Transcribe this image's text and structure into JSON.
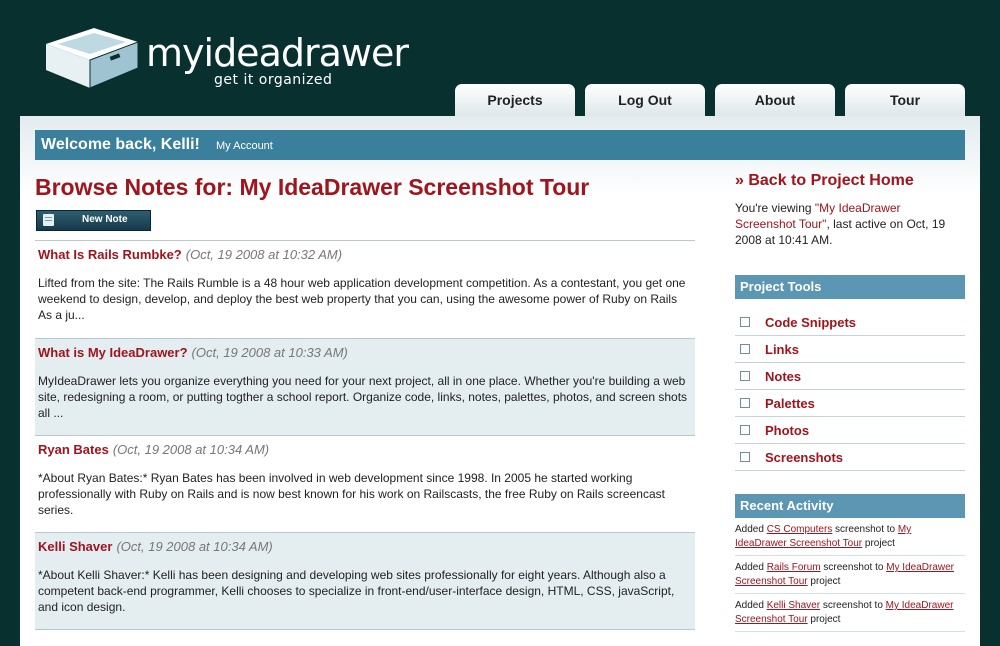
{
  "header": {
    "brand": "myideadrawer",
    "tagline": "get it organized",
    "tabs": [
      {
        "label": "Projects"
      },
      {
        "label": "Log Out"
      },
      {
        "label": "About"
      },
      {
        "label": "Tour"
      }
    ]
  },
  "welcome": {
    "greeting": "Welcome back, Kelli!",
    "account_link": "My Account"
  },
  "main": {
    "title": "Browse Notes for: My IdeaDrawer Screenshot Tour",
    "new_note_label": "New Note",
    "notes": [
      {
        "title": "What Is Rails Rumbke?",
        "date": "(Oct, 19 2008 at 10:32 AM)",
        "body": "Lifted from the site: The Rails Rumble is a 48 hour web application development competition. As a contestant, you get one weekend to design, develop, and deploy the best web property that you can, using the awesome power of Ruby on Rails As a ju..."
      },
      {
        "title": "What is My IdeaDrawer?",
        "date": "(Oct, 19 2008 at 10:33 AM)",
        "body": "MyIdeaDrawer lets you organize everything you need for your next project, all in one place. Whether you're building a web site, redesigning a room, or putting togther a school report. Organize code, links, notes, palettes, photos, and screen shots all ..."
      },
      {
        "title": "Ryan Bates",
        "date": "(Oct, 19 2008 at 10:34 AM)",
        "body": "*About Ryan Bates:* Ryan Bates has been involved in web development since 1998. In 2005 he started working professionally with Ruby on Rails and is now best known for his work on Railscasts, the free Ruby on Rails screencast series."
      },
      {
        "title": "Kelli Shaver",
        "date": "(Oct, 19 2008 at 10:34 AM)",
        "body": "*About Kelli Shaver:* Kelli has been designing and developing web sites professionally for eight years. Although also a competent back-end programmer, Kelli chooses to specialize in front-end/user-interface design, HTML, CSS, javaScript, and icon design."
      }
    ]
  },
  "sidebar": {
    "back_link": "» Back to Project Home",
    "viewing": {
      "prefix": "You're viewing ",
      "project": "\"My IdeaDrawer Screenshot Tour\"",
      "suffix": ", last active on Oct, 19 2008 at 10:41 AM."
    },
    "tools_title": "Project Tools",
    "tools": [
      {
        "label": "Code Snippets"
      },
      {
        "label": "Links"
      },
      {
        "label": "Notes"
      },
      {
        "label": "Palettes"
      },
      {
        "label": "Photos"
      },
      {
        "label": "Screenshots"
      }
    ],
    "activity_title": "Recent Activity",
    "activity": [
      {
        "pre": "Added ",
        "item": "CS Computers",
        "mid": " screenshot to ",
        "project": "My IdeaDrawer Screenshot Tour",
        "post": " project"
      },
      {
        "pre": "Added ",
        "item": "Rails Forum",
        "mid": " screenshot to ",
        "project": "My IdeaDrawer Screenshot Tour",
        "post": " project"
      },
      {
        "pre": "Added ",
        "item": "Kelli Shaver",
        "mid": " screenshot to ",
        "project": "My IdeaDrawer Screenshot Tour",
        "post": " project"
      }
    ]
  },
  "colors": {
    "background": "#07302f",
    "accent_red": "#a0141e",
    "bar_blue": "#3a7f9c",
    "box_blue": "#5b97b3"
  }
}
